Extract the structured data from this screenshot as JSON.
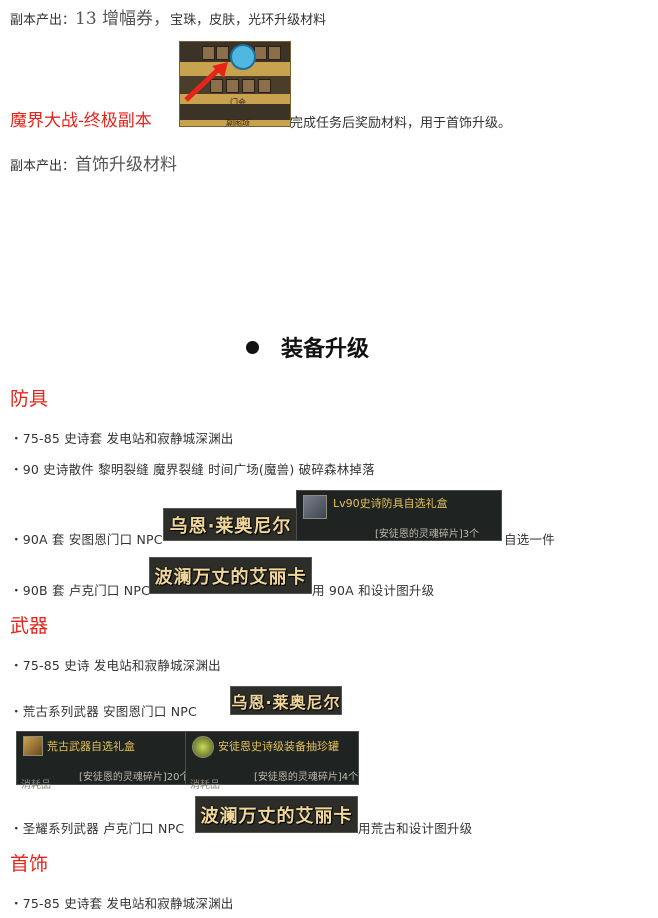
{
  "line1": {
    "label": "副本产出：",
    "value": "13 增幅券，",
    "rest": "宝珠，皮肤，光环升级材料"
  },
  "dungeon": {
    "title": "魔界大战-终极副本",
    "suffix": "完成任务后奖励材料，用于首饰升级。",
    "map_labels": [
      "门会",
      "副图项"
    ]
  },
  "line3": {
    "label": "副本产出：",
    "value": "首饰升级材料"
  },
  "heading": {
    "title": "装备升级"
  },
  "armor": {
    "title": "防具",
    "lines": [
      "・75-85 史诗套 发电站和寂静城深渊出",
      "・90 史诗散件 黎明裂缝 魔界裂缝 时间广场(魔兽) 破碎森林掉落"
    ],
    "row90a": {
      "prefix": "・90A 套 安图恩门口 NPC",
      "npc": "乌恩·莱奥尼尔",
      "item_name": "Lv90史诗防具自选礼盒",
      "item_sub": "[安徒恩的灵魂碎片]3个",
      "suffix": "自选一件"
    },
    "row90b": {
      "prefix": "・90B 套 卢克门口 NPC",
      "npc": "波澜万丈的艾丽卡",
      "suffix": "用 90A 和设计图升级"
    }
  },
  "weapon": {
    "title": "武器",
    "line1": "・75-85 史诗 发电站和寂静城深渊出",
    "row_huanggu": {
      "prefix": "・荒古系列武器 安图恩门口 NPC",
      "npc": "乌恩·莱奥尼尔"
    },
    "items": [
      {
        "name": "荒古武器自选礼盒",
        "sub": "[安徒恩的灵魂碎片]20个",
        "corner": "消耗品"
      },
      {
        "name": "安徒恩史诗级装备抽珍罐",
        "sub": "[安徒恩的灵魂碎片]4个",
        "corner": "消耗品"
      }
    ],
    "row_shengyao": {
      "prefix": "・圣耀系列武器 卢克门口 NPC",
      "npc": "波澜万丈的艾丽卡",
      "suffix": "用荒古和设计图升级"
    }
  },
  "accessory": {
    "title": "首饰",
    "line1": "・75-85 史诗套 发电站和寂静城深渊出"
  },
  "colors": {
    "red": "#e8231a",
    "npc_text": "#f0d79a",
    "item_gold": "#e2c15a"
  }
}
